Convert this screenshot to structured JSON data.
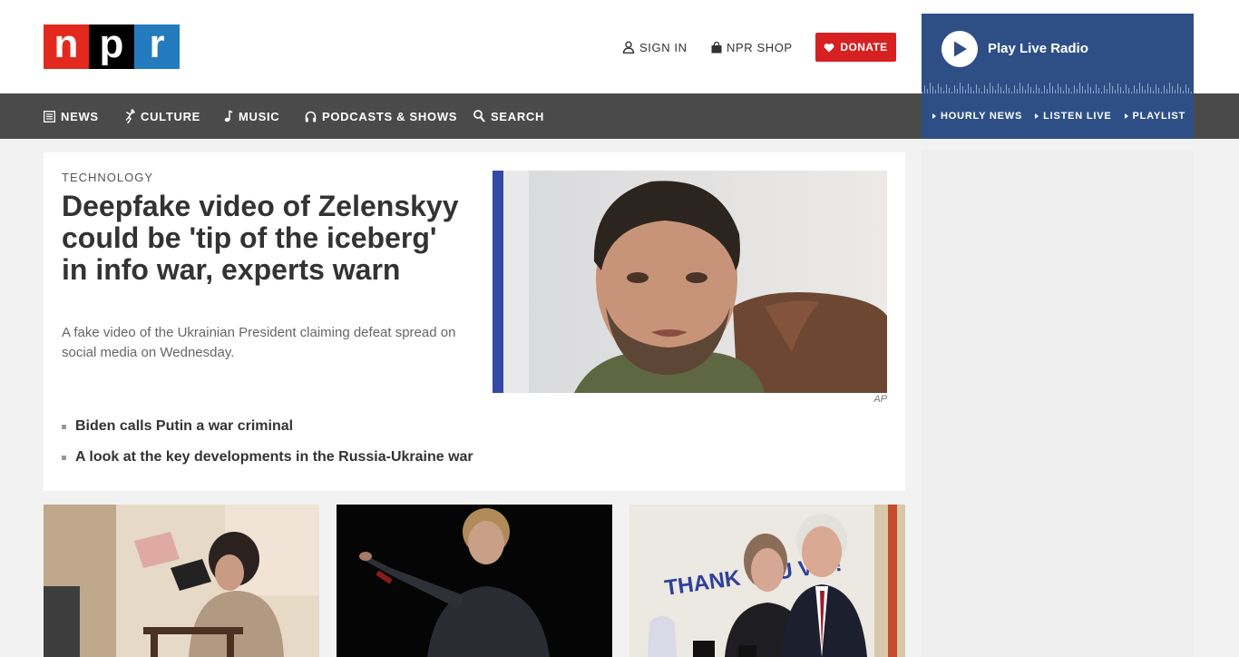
{
  "logo": {
    "letters": [
      "n",
      "p",
      "r"
    ]
  },
  "header": {
    "sign_in": "SIGN IN",
    "shop": "NPR SHOP",
    "donate": "DONATE"
  },
  "nav": {
    "items": [
      {
        "label": "NEWS",
        "icon": "newspaper-icon"
      },
      {
        "label": "CULTURE",
        "icon": "dancer-icon"
      },
      {
        "label": "MUSIC",
        "icon": "music-note-icon"
      },
      {
        "label": "PODCASTS & SHOWS",
        "icon": "headphones-icon"
      },
      {
        "label": "SEARCH",
        "icon": "search-icon"
      }
    ]
  },
  "radio": {
    "title": "Play Live Radio",
    "links": [
      "HOURLY NEWS",
      "LISTEN LIVE",
      "PLAYLIST"
    ]
  },
  "feature": {
    "slug": "TECHNOLOGY",
    "headline": "Deepfake video of Zelenskyy could be 'tip of the iceberg' in info war, experts warn",
    "teaser": "A fake video of the Ukrainian President claiming defeat spread on social media on Wednesday.",
    "credit": "AP",
    "related": [
      "Biden calls Putin a war criminal",
      "A look at the key developments in the Russia-Ukraine war"
    ]
  },
  "cards": {
    "card3_sign": "THANK YOU VIC!"
  },
  "colors": {
    "npr_red": "#e3291e",
    "npr_blue": "#237bbd",
    "donate": "#d62021",
    "nav_bg": "#4a4a4a",
    "radio_bg": "#2e4f86"
  }
}
